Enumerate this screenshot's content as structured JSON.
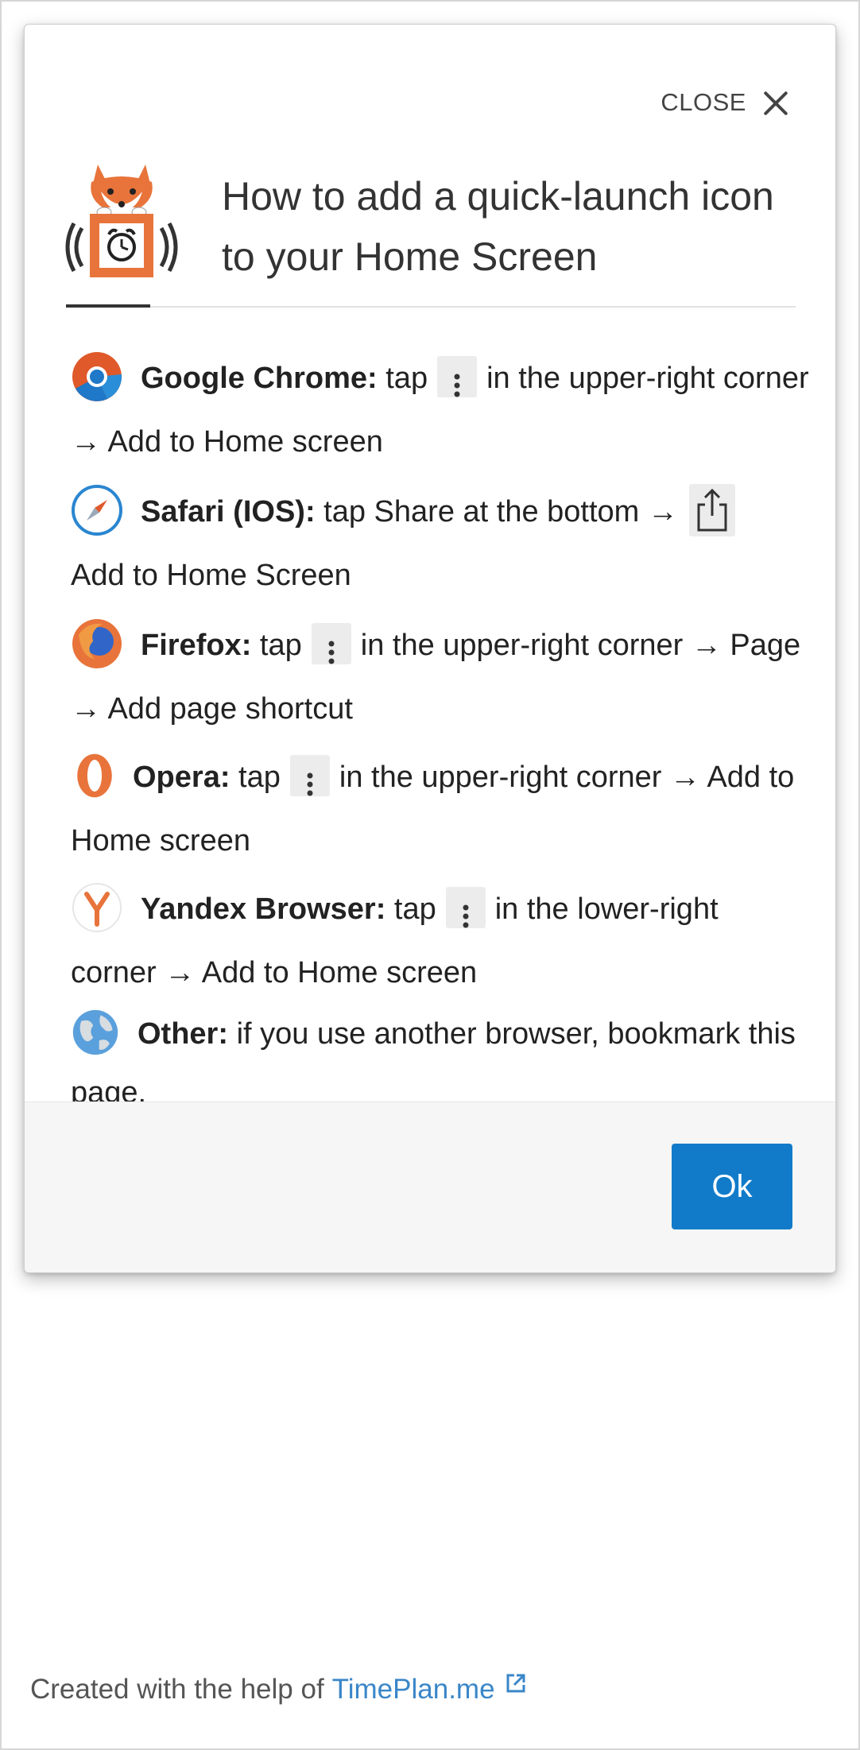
{
  "modal": {
    "close_label": "CLOSE",
    "title": "How to add a quick-launch icon to your Home Screen",
    "ok_label": "Ok"
  },
  "instructions": [
    {
      "icon": "chrome-icon",
      "name": "Google Chrome:",
      "before": "tap",
      "menu": "kebab-menu-icon",
      "after": "in the upper-right corner → Add to Home screen"
    },
    {
      "icon": "safari-icon",
      "name": "Safari (IOS):",
      "before": "tap Share at the bottom →",
      "menu": "share-icon",
      "after": "Add to Home Screen"
    },
    {
      "icon": "firefox-icon",
      "name": "Firefox:",
      "before": "tap",
      "menu": "kebab-menu-icon",
      "after": "in the upper-right corner → Page → Add page shortcut"
    },
    {
      "icon": "opera-icon",
      "name": "Opera:",
      "before": "tap",
      "menu": "kebab-menu-icon",
      "after": "in the upper-right corner → Add to Home screen"
    },
    {
      "icon": "yandex-icon",
      "name": "Yandex Browser:",
      "before": "tap",
      "menu": "kebab-menu-icon",
      "after": "in the lower-right corner → Add to Home screen"
    },
    {
      "icon": "globe-icon",
      "name": "Other:",
      "before": "if you use another browser, bookmark this page."
    }
  ],
  "footer": {
    "credit_text": "Created with the help of",
    "credit_link": "TimePlan.me"
  },
  "colors": {
    "ok_button": "#127bc9",
    "link": "#3a86c8",
    "brand_orange": "#e8743b"
  }
}
